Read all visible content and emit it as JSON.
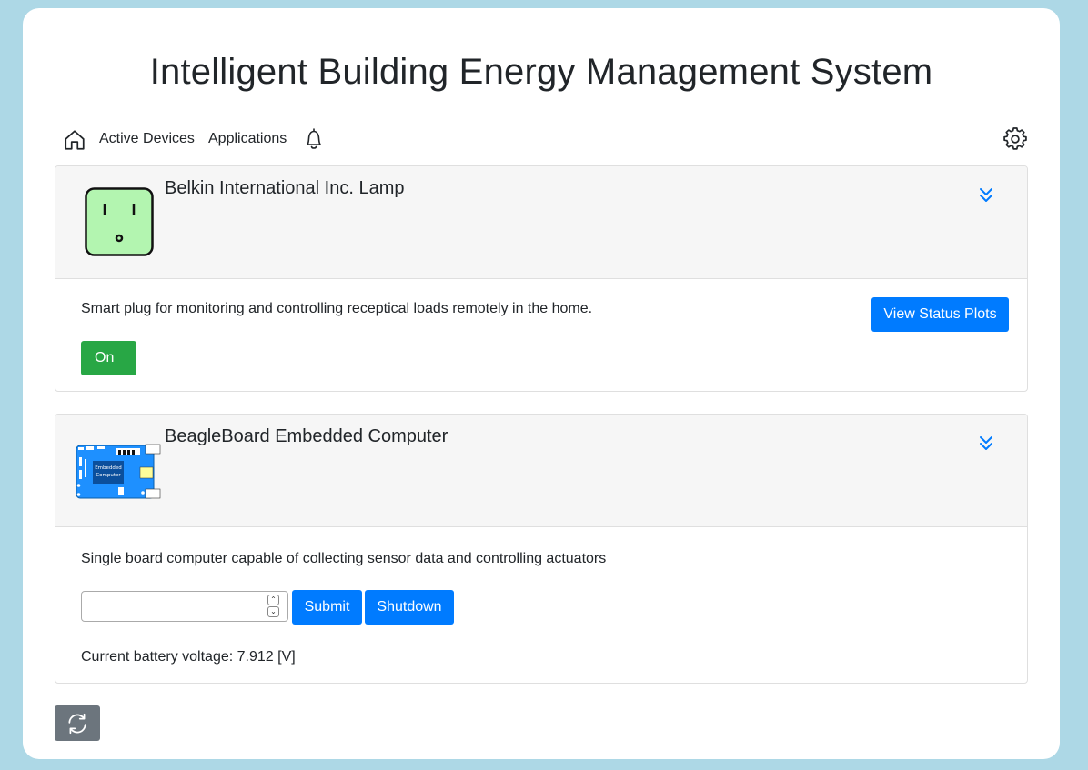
{
  "header": {
    "title": "Intelligent Building Energy Management System"
  },
  "nav": {
    "home_icon": "home-icon",
    "active_devices": "Active Devices",
    "applications": "Applications",
    "bell_icon": "bell-icon",
    "settings_icon": "gear-icon"
  },
  "devices": [
    {
      "name": "Belkin International Inc. Lamp",
      "icon": "smart-plug-icon",
      "description": "Smart plug for monitoring and controlling receptical loads remotely in the home.",
      "status_plots_label": "View Status Plots",
      "toggle_label": "On"
    },
    {
      "name": "BeagleBoard Embedded Computer",
      "icon": "circuit-board-icon",
      "board_label_line1": "Embedded",
      "board_label_line2": "Computer",
      "description": "Single board computer capable of collecting sensor data and controlling actuators",
      "input_value": "",
      "submit_label": "Submit",
      "shutdown_label": "Shutdown",
      "battery_text": "Current battery voltage: 7.912 [V]"
    }
  ],
  "refresh_icon": "refresh-icon",
  "colors": {
    "background": "#add8e6",
    "primary": "#007bff",
    "success": "#28a745",
    "secondary": "#6c757d"
  }
}
